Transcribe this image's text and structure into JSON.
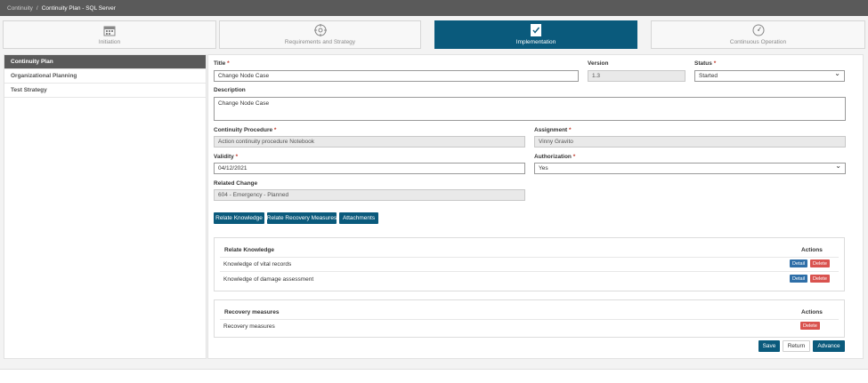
{
  "breadcrumb": {
    "root": "Continuity",
    "separator": "/",
    "current": "Continuity Plan - SQL Server"
  },
  "steps": [
    {
      "label": "Initiation",
      "icon": "calendar-icon"
    },
    {
      "label": "Requirements and Strategy",
      "icon": "target-icon"
    },
    {
      "label": "Implementation",
      "icon": "checklist-icon"
    },
    {
      "label": "Continuous Operation",
      "icon": "gauge-icon"
    }
  ],
  "sidebar": {
    "items": [
      {
        "label": "Continuity Plan"
      },
      {
        "label": "Organizational Planning"
      },
      {
        "label": "Test Strategy"
      }
    ]
  },
  "form": {
    "required_mark": "*",
    "title_label": "Title",
    "title_value": "Change Node Case",
    "version_label": "Version",
    "version_value": "1.3",
    "status_label": "Status",
    "status_value": "Started",
    "description_label": "Description",
    "description_value": "Change Node Case",
    "procedure_label": "Continuity Procedure",
    "procedure_value": "Action continuity procedure Notebook",
    "assignment_label": "Assignment",
    "assignment_value": "Vinny Gravito",
    "validity_label": "Validity",
    "validity_value": "04/12/2021",
    "authorization_label": "Authorization",
    "authorization_value": "Yes",
    "related_change_label": "Related Change",
    "related_change_value": "604 - Emergency - Planned"
  },
  "action_buttons": {
    "relate_knowledge": "Relate Knowledge",
    "relate_recovery": "Relate Recovery Measures",
    "attachments": "Attachments"
  },
  "knowledge_panel": {
    "header": "Relate Knowledge",
    "actions_header": "Actions",
    "rows": [
      {
        "name": "Knowledge of vital records",
        "detail": "Detail",
        "delete": "Delete"
      },
      {
        "name": "Knowledge of damage assessment",
        "detail": "Detail",
        "delete": "Delete"
      }
    ]
  },
  "recovery_panel": {
    "header": "Recovery measures",
    "actions_header": "Actions",
    "rows": [
      {
        "name": "Recovery measures",
        "delete": "Delete"
      }
    ]
  },
  "footer_buttons": {
    "save": "Save",
    "return": "Return",
    "advance": "Advance"
  },
  "colors": {
    "primary": "#0a5a7c",
    "detail": "#2f6fa8",
    "delete": "#d9534f",
    "topbar": "#5a5a5a"
  }
}
